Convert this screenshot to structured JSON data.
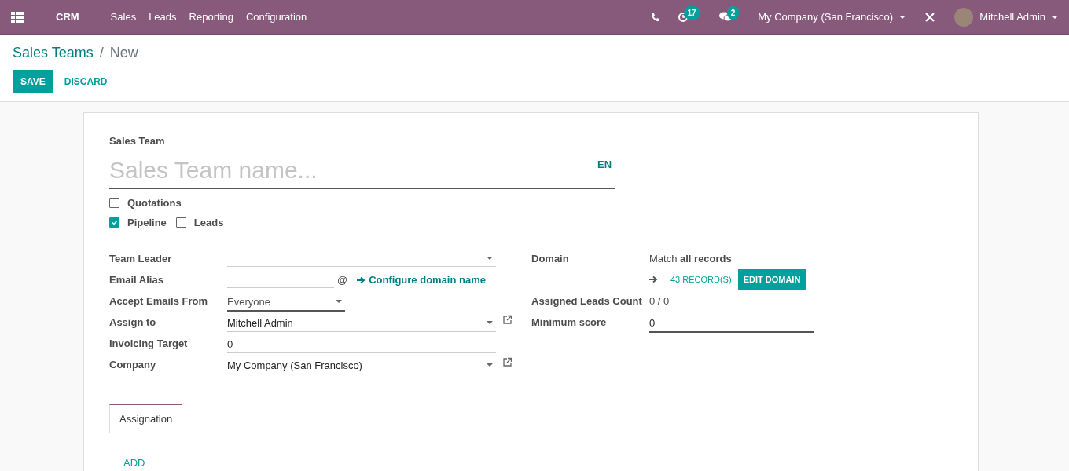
{
  "navbar": {
    "app_name": "CRM",
    "menu": [
      "Sales",
      "Leads",
      "Reporting",
      "Configuration"
    ],
    "activity_count": "17",
    "message_count": "2",
    "company": "My Company (San Francisco)",
    "user": "Mitchell Admin"
  },
  "breadcrumb": [
    "Sales Teams",
    "New"
  ],
  "breadcrumb_separator": "/",
  "buttons": [
    {
      "label": "SAVE",
      "kind": "primary"
    },
    {
      "label": "DISCARD",
      "kind": "link"
    }
  ],
  "form": {
    "name_label": "Sales Team",
    "name_placeholder": "Sales Team name...",
    "language": "EN",
    "option_rows": [
      [
        {
          "label": "Quotations",
          "checked": false
        }
      ],
      [
        {
          "label": "Pipeline",
          "checked": true
        },
        {
          "label": "Leads",
          "checked": false
        }
      ]
    ],
    "left_fields": [
      {
        "kind": "many2one",
        "label": "Team Leader",
        "external_link": false
      },
      {
        "kind": "alias",
        "label": "Email Alias",
        "suffix": "@",
        "link": "Configure domain name"
      },
      {
        "kind": "selection",
        "label": "Accept Emails From",
        "value": "Everyone"
      },
      {
        "kind": "many2one",
        "label": "Assign to",
        "value": "Mitchell Admin",
        "external_link": true
      },
      {
        "kind": "char",
        "label": "Invoicing Target",
        "value": "0"
      },
      {
        "kind": "many2one",
        "label": "Company",
        "value": "My Company (San Francisco)",
        "external_link": true
      }
    ],
    "right_fields": [
      {
        "kind": "domain",
        "label": "Domain",
        "text": "Match **all records**",
        "records": "43 RECORD(S)",
        "button": "EDIT DOMAIN"
      },
      {
        "kind": "readonly",
        "label": "Assigned Leads Count",
        "value": "0 / 0"
      },
      {
        "kind": "input",
        "label": "Minimum score",
        "value": "0"
      }
    ],
    "tabs": [
      {
        "label": "Assignation",
        "selected": true
      }
    ],
    "add_label": "ADD"
  }
}
